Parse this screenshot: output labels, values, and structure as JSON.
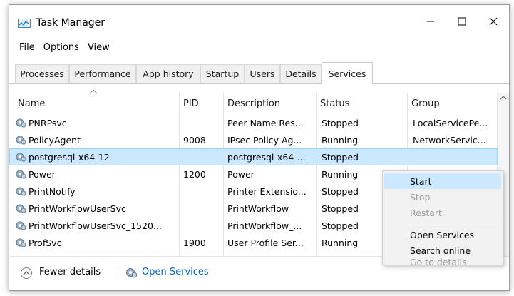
{
  "window": {
    "title": "Task Manager"
  },
  "menu": [
    "File",
    "Options",
    "View"
  ],
  "tabs": [
    {
      "label": "Processes"
    },
    {
      "label": "Performance"
    },
    {
      "label": "App history"
    },
    {
      "label": "Startup"
    },
    {
      "label": "Users"
    },
    {
      "label": "Details"
    },
    {
      "label": "Services",
      "active": true
    }
  ],
  "table": {
    "columns": [
      "Name",
      "PID",
      "Description",
      "Status",
      "Group"
    ],
    "rows": [
      {
        "name": "PNRPsvc",
        "pid": "",
        "description": "Peer Name Res...",
        "status": "Stopped",
        "group": "LocalServicePe..."
      },
      {
        "name": "PolicyAgent",
        "pid": "9008",
        "description": "IPsec Policy Ag...",
        "status": "Running",
        "group": "NetworkServic..."
      },
      {
        "name": "postgresql-x64-12",
        "pid": "",
        "description": "postgresql-x64-...",
        "status": "Stopped",
        "group": "",
        "selected": true
      },
      {
        "name": "Power",
        "pid": "1200",
        "description": "Power",
        "status": "Running",
        "group": ""
      },
      {
        "name": "PrintNotify",
        "pid": "",
        "description": "Printer Extensio...",
        "status": "Stopped",
        "group": ""
      },
      {
        "name": "PrintWorkflowUserSvc",
        "pid": "",
        "description": "PrintWorkflow",
        "status": "Stopped",
        "group": ""
      },
      {
        "name": "PrintWorkflowUserSvc_1520...",
        "pid": "",
        "description": "PrintWorkflow_...",
        "status": "Stopped",
        "group": ""
      },
      {
        "name": "ProfSvc",
        "pid": "1900",
        "description": "User Profile Ser...",
        "status": "Running",
        "group": ""
      }
    ]
  },
  "footer": {
    "fewer_details": "Fewer details",
    "open_services": "Open Services"
  },
  "context_menu": {
    "items": [
      {
        "label": "Start",
        "highlighted": true,
        "disabled": false
      },
      {
        "label": "Stop",
        "disabled": true
      },
      {
        "label": "Restart",
        "disabled": true
      },
      {
        "label": "Open Services",
        "disabled": false
      },
      {
        "label": "Search online",
        "disabled": false
      },
      {
        "label": "Go to details",
        "disabled": true
      }
    ]
  },
  "colors": {
    "selection": "#cce8ff",
    "link": "#0066cc"
  },
  "icons": {
    "app": "task-manager-icon",
    "service": "gear-service-icon"
  }
}
